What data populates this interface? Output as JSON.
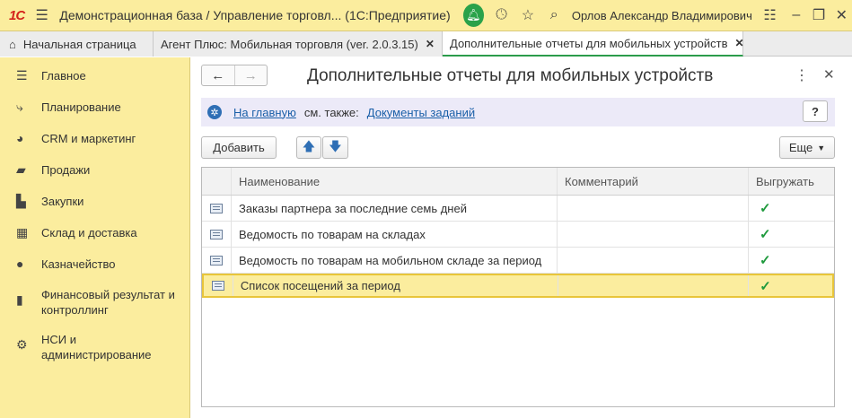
{
  "titlebar": {
    "logo": "1С",
    "title": "Демонстрационная база / Управление торговл...  (1С:Предприятие)",
    "user": "Орлов Александр Владимирович"
  },
  "tabs": [
    {
      "label": "Начальная страница"
    },
    {
      "label": "Агент Плюс: Мобильная торговля (ver. 2.0.3.15)"
    },
    {
      "label": "Дополнительные отчеты для мобильных устройств"
    }
  ],
  "sidebar": {
    "items": [
      {
        "label": "Главное",
        "icon": "menu-lines-icon"
      },
      {
        "label": "Планирование",
        "icon": "planning-icon"
      },
      {
        "label": "CRM и маркетинг",
        "icon": "pie-chart-icon"
      },
      {
        "label": "Продажи",
        "icon": "shopping-bag-icon"
      },
      {
        "label": "Закупки",
        "icon": "cart-icon"
      },
      {
        "label": "Склад и доставка",
        "icon": "warehouse-icon"
      },
      {
        "label": "Казначейство",
        "icon": "ruble-coin-icon"
      },
      {
        "label": "Финансовый результат и контроллинг",
        "icon": "bar-chart-icon"
      },
      {
        "label": "НСИ и администрирование",
        "icon": "gear-icon"
      }
    ]
  },
  "form": {
    "title": "Дополнительные отчеты для мобильных устройств",
    "home_link": "На главную",
    "see_also": "см. также:",
    "tasks_link": "Документы заданий",
    "help": "?",
    "add_label": "Добавить",
    "more_label": "Еще"
  },
  "table": {
    "columns": [
      "Наименование",
      "Комментарий",
      "Выгружать"
    ],
    "rows": [
      {
        "name": "Заказы партнера за последние семь дней",
        "comment": "",
        "export": true
      },
      {
        "name": "Ведомость по товарам на складах",
        "comment": "",
        "export": true
      },
      {
        "name": "Ведомость по товарам на мобильном складе за период",
        "comment": "",
        "export": true
      },
      {
        "name": "Список посещений за период",
        "comment": "",
        "export": true
      }
    ],
    "selected_row": 3
  },
  "colors": {
    "accent_yellow": "#fbed9e",
    "active_tab_line": "#2b9c4b",
    "link": "#1a5fa8",
    "check": "#1f9a3d"
  }
}
